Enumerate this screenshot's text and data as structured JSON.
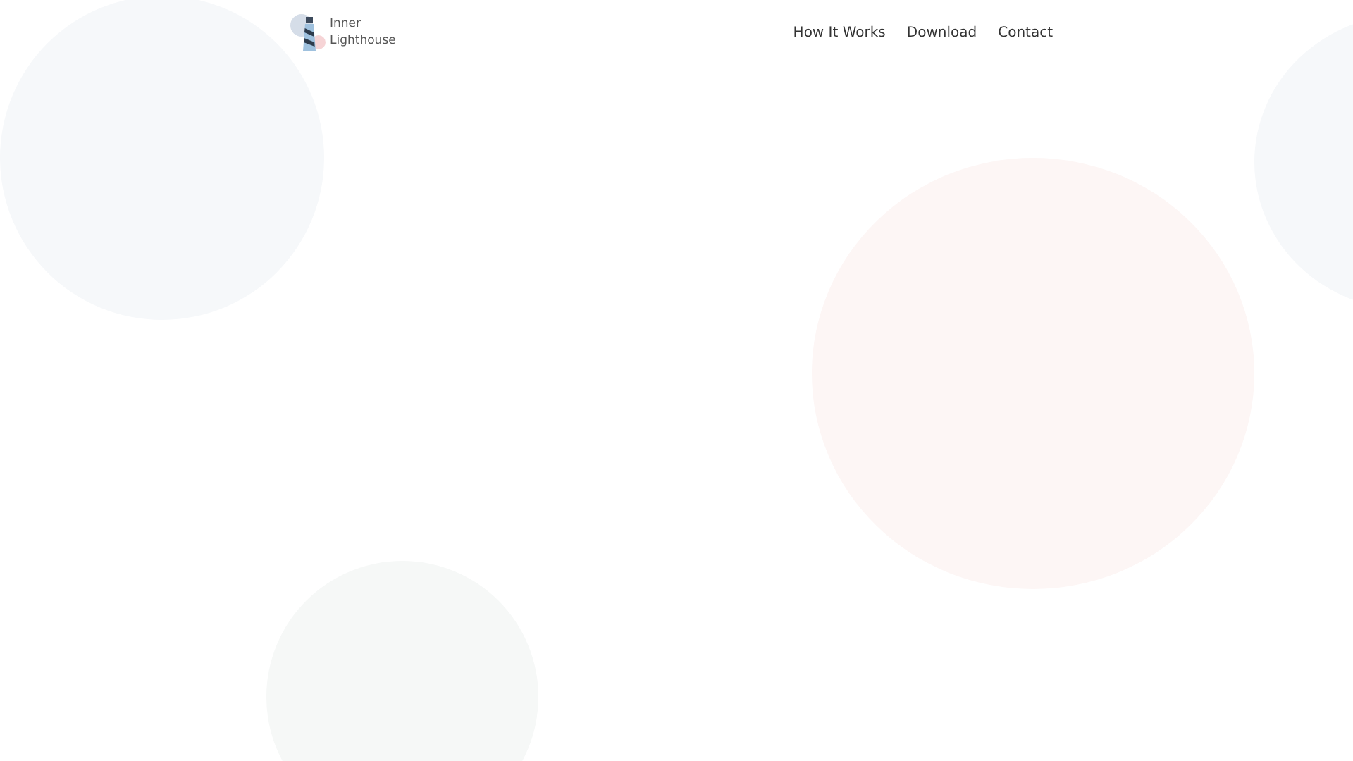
{
  "logo": {
    "lines": [
      "Inner",
      "Lighthouse"
    ]
  },
  "nav": [
    {
      "label": "How It Works"
    },
    {
      "label": "Download"
    },
    {
      "label": "Contact"
    }
  ]
}
